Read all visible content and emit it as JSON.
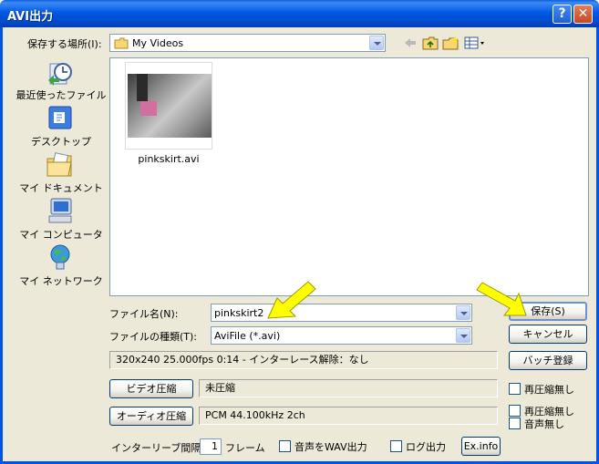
{
  "window": {
    "title": "AVI出力"
  },
  "titlebar": {
    "help": "?",
    "close": "✕"
  },
  "toolbar": {
    "save_in_label": "保存する場所(I):",
    "save_in_value": "My Videos"
  },
  "places": [
    {
      "label": "最近使ったファイル",
      "icon": "recent-files-icon"
    },
    {
      "label": "デスクトップ",
      "icon": "desktop-icon"
    },
    {
      "label": "マイ ドキュメント",
      "icon": "my-documents-icon"
    },
    {
      "label": "マイ コンピュータ",
      "icon": "my-computer-icon"
    },
    {
      "label": "マイ ネットワーク",
      "icon": "my-network-icon"
    }
  ],
  "files": [
    {
      "name": "pinkskirt.avi"
    }
  ],
  "form": {
    "filename_label": "ファイル名(N):",
    "filename_value": "pinkskirt2",
    "filetype_label": "ファイルの種類(T):",
    "filetype_value": "AviFile (*.avi)",
    "save_button": "保存(S)",
    "cancel_button": "キャンセル",
    "batch_button": "バッチ登録"
  },
  "info": {
    "summary": "320x240  25.000fps  0:14  -  インターレース解除：なし"
  },
  "video": {
    "button": "ビデオ圧縮",
    "value": "未圧縮",
    "no_recompress": "再圧縮無し"
  },
  "audio": {
    "button": "オーディオ圧縮",
    "value": "PCM 44.100kHz 2ch",
    "no_recompress": "再圧縮無し",
    "no_audio": "音声無し"
  },
  "bottom": {
    "interleave_label": "インターリーブ間隔：",
    "interleave_value": "1",
    "frame_label": "フレーム",
    "wav_output": "音声をWAV出力",
    "log_output": "ログ出力",
    "exinfo_button": "Ex.info"
  },
  "colors": {
    "titlebar": "#0054e3",
    "dialog_bg": "#ece9d8",
    "annotation_arrow": "#ffff00"
  }
}
